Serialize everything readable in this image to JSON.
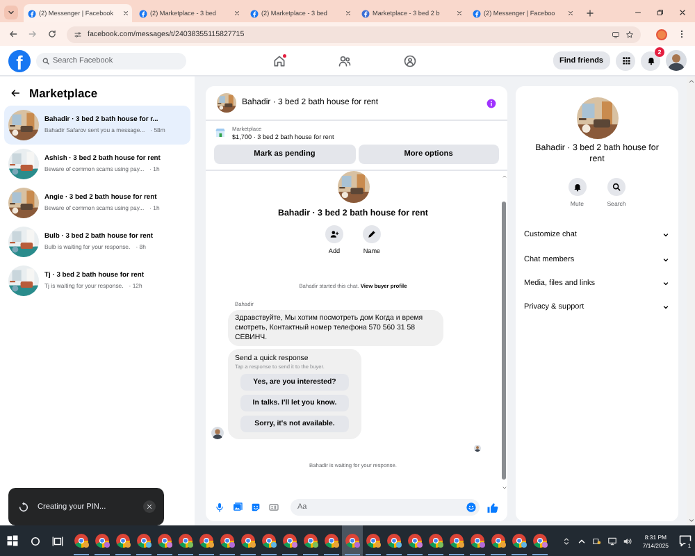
{
  "browser": {
    "tabs": [
      {
        "title": "(2) Messenger | Facebook",
        "selected": true
      },
      {
        "title": "(2) Marketplace - 3 bed",
        "selected": false
      },
      {
        "title": "(2) Marketplace - 3 bed",
        "selected": false
      },
      {
        "title": "Marketplace - 3 bed 2 b",
        "selected": false
      },
      {
        "title": "(2) Messenger | Faceboo",
        "selected": false
      }
    ],
    "url": "facebook.com/messages/t/24038355115827715"
  },
  "header": {
    "logo": "f",
    "search": {
      "placeholder": "Search Facebook"
    },
    "nav": [
      {
        "kind": "home",
        "alert": true
      },
      {
        "kind": "friends",
        "alert": false
      },
      {
        "kind": "groups",
        "alert": false
      }
    ],
    "find_friends": "Find friends",
    "notifications": "2"
  },
  "sidebar": {
    "title": "Marketplace",
    "conversations": [
      {
        "title": "Bahadir · 3 bed 2 bath house for r...",
        "preview": "Bahadir Safarov sent you a message...",
        "time": "· 58m",
        "selected": true
      },
      {
        "title": "Ashish · 3 bed 2 bath house for rent",
        "preview": "Beware of common scams using pay...",
        "time": "· 1h",
        "selected": false
      },
      {
        "title": "Angie · 3 bed 2 bath house for rent",
        "preview": "Beware of common scams using pay...",
        "time": "· 1h",
        "selected": false
      },
      {
        "title": "Bulb · 3 bed 2 bath house for rent",
        "preview": "Bulb is waiting for your response.",
        "time": "· 8h",
        "selected": false
      },
      {
        "title": "Tj · 3 bed 2 bath house for rent",
        "preview": "Tj is waiting for your response.",
        "time": "· 12h",
        "selected": false
      }
    ]
  },
  "chat": {
    "title": "Bahadir · 3 bed 2 bath house for rent",
    "listing": {
      "label": "Marketplace",
      "text": "$1,700 · 3 bed 2 bath house for rent"
    },
    "buttons": [
      "Mark as pending",
      "More options"
    ],
    "profile": {
      "name": "Bahadir · 3 bed 2 bath house for rent",
      "actions": [
        {
          "kind": "add",
          "label": "Add"
        },
        {
          "kind": "name",
          "label": "Name"
        }
      ]
    },
    "started": {
      "text": "Bahadir started this chat.",
      "link": "View buyer profile"
    },
    "sender": "Bahadir",
    "message": "Здравствуйте, Мы хотим посмотреть дом Когда и время смотреть, Контактный номер телефона 570 560 31 58 СЕВИНЧ.",
    "quick_response": {
      "title": "Send a quick response",
      "hint": "Tap a response to send it to the buyer.",
      "options": [
        "Yes, are you interested?",
        "In talks. I'll let you know.",
        "Sorry, it's not available."
      ]
    },
    "status": "Bahadir is waiting for your response.",
    "composer": {
      "placeholder": "Aa"
    }
  },
  "details": {
    "name": "Bahadir · 3 bed 2 bath house for rent",
    "actions": [
      {
        "kind": "mute",
        "label": "Mute"
      },
      {
        "kind": "search",
        "label": "Search"
      }
    ],
    "sections": [
      {
        "label": "Customize chat",
        "expanded": false
      },
      {
        "label": "Chat members",
        "expanded": false
      },
      {
        "label": "Media, files and links",
        "expanded": false
      },
      {
        "label": "Privacy & support",
        "expanded": false
      }
    ]
  },
  "toast": {
    "text": "Creating your PIN..."
  },
  "taskbar": {
    "apps": [
      {
        "selected": false
      },
      {
        "selected": false
      },
      {
        "selected": false
      },
      {
        "selected": false
      },
      {
        "selected": false
      },
      {
        "selected": false
      },
      {
        "selected": false
      },
      {
        "selected": false
      },
      {
        "selected": false
      },
      {
        "selected": false
      },
      {
        "selected": false
      },
      {
        "selected": false
      },
      {
        "selected": false
      },
      {
        "selected": true
      },
      {
        "selected": false
      },
      {
        "selected": false
      },
      {
        "selected": false
      },
      {
        "selected": false
      },
      {
        "selected": false
      },
      {
        "selected": false
      },
      {
        "selected": false
      },
      {
        "selected": false
      },
      {
        "selected": false
      }
    ],
    "time": "8:31 PM",
    "date": "7/14/2025",
    "notifications": "1"
  }
}
